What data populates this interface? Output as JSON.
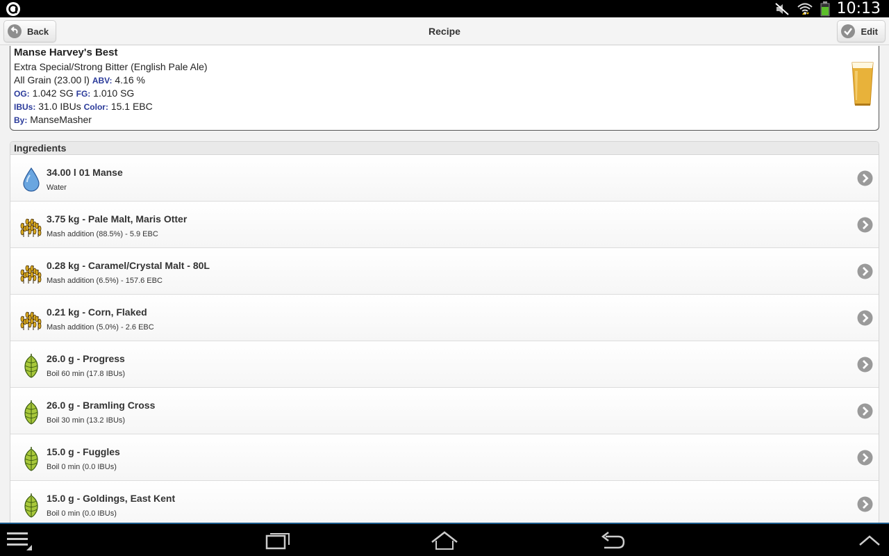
{
  "status_bar": {
    "time": "10:13"
  },
  "header": {
    "title": "Recipe",
    "back_label": "Back",
    "edit_label": "Edit"
  },
  "recipe": {
    "name": "Manse Harvey's Best",
    "style": "Extra Special/Strong Bitter (English Pale Ale)",
    "type_batch": "All Grain (23.00 l)",
    "abv_label": "ABV:",
    "abv": "4.16 %",
    "og_label": "OG:",
    "og": "1.042 SG",
    "fg_label": "FG:",
    "fg": "1.010 SG",
    "ibus_label": "IBUs:",
    "ibus": "31.0 IBUs",
    "color_label": "Color:",
    "color": "15.1 EBC",
    "by_label": "By:",
    "by": "ManseMasher"
  },
  "ingredients": {
    "header": "Ingredients",
    "items": [
      {
        "icon": "water-drop-icon",
        "title": "34.00 l 01 Manse",
        "subtitle": "Water"
      },
      {
        "icon": "grain-icon",
        "title": "3.75 kg - Pale Malt, Maris Otter",
        "subtitle": "Mash addition (88.5%) - 5.9 EBC"
      },
      {
        "icon": "grain-icon",
        "title": "0.28 kg - Caramel/Crystal Malt - 80L",
        "subtitle": "Mash addition (6.5%) - 157.6 EBC"
      },
      {
        "icon": "grain-icon",
        "title": "0.21 kg - Corn, Flaked",
        "subtitle": "Mash addition (5.0%) - 2.6 EBC"
      },
      {
        "icon": "hop-icon",
        "title": "26.0 g - Progress",
        "subtitle": "Boil 60 min (17.8 IBUs)"
      },
      {
        "icon": "hop-icon",
        "title": "26.0 g - Bramling Cross",
        "subtitle": "Boil 30 min (13.2 IBUs)"
      },
      {
        "icon": "hop-icon",
        "title": "15.0 g - Fuggles",
        "subtitle": "Boil 0 min (0.0 IBUs)"
      },
      {
        "icon": "hop-icon",
        "title": "15.0 g - Goldings, East Kent",
        "subtitle": "Boil 0 min (0.0 IBUs)"
      }
    ]
  },
  "colors": {
    "label_blue": "#2a3a9a",
    "nav_accent": "#1a5a8a"
  }
}
